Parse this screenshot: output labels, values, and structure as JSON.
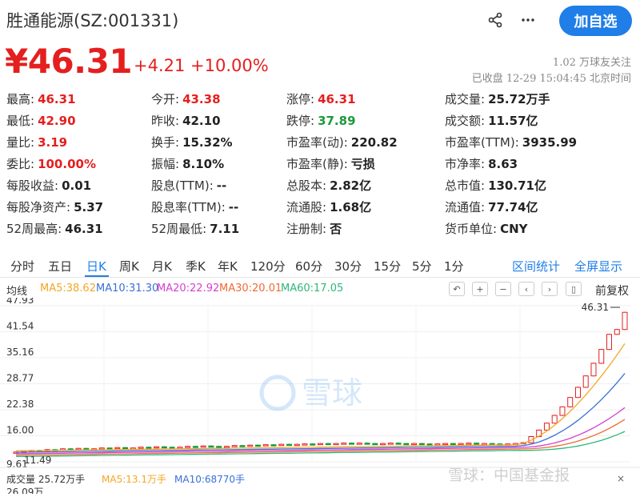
{
  "header": {
    "stock_name": "胜通能源(SZ:001331)",
    "add_button": "加自选",
    "share_icon": "share-icon",
    "more_icon": "more-icon"
  },
  "quote": {
    "price": "¥46.31",
    "change": "+4.21 +10.00%",
    "followers": "1.02 万球友关注",
    "status": "已收盘 12-29 15:04:45 北京时间"
  },
  "metrics": [
    [
      {
        "label": "最高:",
        "value": "46.31",
        "color": "red"
      },
      {
        "label": "今开:",
        "value": "43.38",
        "color": "red"
      },
      {
        "label": "涨停:",
        "value": "46.31",
        "color": "red"
      },
      {
        "label": "成交量:",
        "value": "25.72万手",
        "color": ""
      }
    ],
    [
      {
        "label": "最低:",
        "value": "42.90",
        "color": "red"
      },
      {
        "label": "昨收:",
        "value": "42.10",
        "color": ""
      },
      {
        "label": "跌停:",
        "value": "37.89",
        "color": "green"
      },
      {
        "label": "成交额:",
        "value": "11.57亿",
        "color": ""
      }
    ],
    [
      {
        "label": "量比:",
        "value": "3.19",
        "color": "red"
      },
      {
        "label": "换手:",
        "value": "15.32%",
        "color": ""
      },
      {
        "label": "市盈率(动):",
        "value": "220.82",
        "color": ""
      },
      {
        "label": "市盈率(TTM):",
        "value": "3935.99",
        "color": ""
      }
    ],
    [
      {
        "label": "委比:",
        "value": "100.00%",
        "color": "red"
      },
      {
        "label": "振幅:",
        "value": "8.10%",
        "color": ""
      },
      {
        "label": "市盈率(静):",
        "value": "亏损",
        "color": ""
      },
      {
        "label": "市净率:",
        "value": "8.63",
        "color": ""
      }
    ],
    [
      {
        "label": "每股收益:",
        "value": "0.01",
        "color": ""
      },
      {
        "label": "股息(TTM):",
        "value": "--",
        "color": ""
      },
      {
        "label": "总股本:",
        "value": "2.82亿",
        "color": ""
      },
      {
        "label": "总市值:",
        "value": "130.71亿",
        "color": ""
      }
    ],
    [
      {
        "label": "每股净资产:",
        "value": "5.37",
        "color": ""
      },
      {
        "label": "股息率(TTM):",
        "value": "--",
        "color": ""
      },
      {
        "label": "流通股:",
        "value": "1.68亿",
        "color": ""
      },
      {
        "label": "流通值:",
        "value": "77.74亿",
        "color": ""
      }
    ],
    [
      {
        "label": "52周最高:",
        "value": "46.31",
        "color": ""
      },
      {
        "label": "52周最低:",
        "value": "7.11",
        "color": ""
      },
      {
        "label": "注册制:",
        "value": "否",
        "color": ""
      },
      {
        "label": "货币单位:",
        "value": "CNY",
        "color": ""
      }
    ]
  ],
  "tabs": {
    "items": [
      "分时",
      "五日",
      "日K",
      "周K",
      "月K",
      "季K",
      "年K",
      "120分",
      "60分",
      "30分",
      "15分",
      "5分",
      "1分"
    ],
    "active": "日K",
    "interval_stats": "区间统计",
    "fullscreen": "全屏显示"
  },
  "ma_bar": {
    "label": "均线",
    "items": [
      {
        "text": "MA5:38.62",
        "color": "#f5a623"
      },
      {
        "text": "MA10:31.30",
        "color": "#3a6fd8"
      },
      {
        "text": "MA20:22.92",
        "color": "#d43fd0"
      },
      {
        "text": "MA30:20.01",
        "color": "#f06a35"
      },
      {
        "text": "MA60:17.05",
        "color": "#2fb77a"
      }
    ],
    "controls": [
      "undo-icon",
      "zoom-in-icon",
      "zoom-out-icon",
      "prev-icon",
      "next-icon",
      "candle-icon"
    ],
    "fuquan": "前复权"
  },
  "chart_data": {
    "type": "candlestick",
    "y_ticks": [
      "47.93",
      "41.54",
      "35.16",
      "28.77",
      "22.38",
      "16.00",
      "9.61"
    ],
    "ylim": [
      9.61,
      47.93
    ],
    "max_label": "46.31",
    "min_label": "11.49",
    "watermark": "雪球",
    "closes": [
      12.0,
      12.2,
      12.4,
      12.3,
      12.6,
      12.5,
      12.8,
      12.7,
      12.9,
      12.6,
      12.8,
      13.0,
      12.9,
      13.1,
      12.9,
      13.0,
      13.2,
      13.1,
      13.3,
      13.2,
      13.0,
      13.2,
      13.4,
      13.3,
      13.5,
      13.4,
      13.2,
      13.4,
      13.6,
      13.5,
      13.7,
      13.6,
      13.8,
      13.7,
      13.9,
      13.8,
      13.9,
      14.0,
      13.9,
      14.1,
      14.0,
      14.1,
      14.2,
      14.1,
      14.2,
      14.1,
      14.0,
      14.1,
      14.2,
      14.1,
      14.0,
      14.1,
      14.0,
      13.9,
      14.0,
      14.1,
      14.0,
      14.1,
      14.2,
      14.0,
      14.1,
      14.0,
      13.9,
      14.0,
      14.1,
      14.3,
      15.8,
      17.4,
      19.1,
      21.0,
      23.1,
      25.4,
      27.9,
      30.7,
      33.8,
      37.2,
      40.9,
      42.1,
      46.31
    ],
    "ma": [
      {
        "name": "MA5",
        "color": "#f5a623",
        "end": 38.62
      },
      {
        "name": "MA10",
        "color": "#3a6fd8",
        "end": 31.3
      },
      {
        "name": "MA20",
        "color": "#d43fd0",
        "end": 22.92
      },
      {
        "name": "MA30",
        "color": "#f06a35",
        "end": 20.01
      },
      {
        "name": "MA60",
        "color": "#2fb77a",
        "end": 17.05
      }
    ]
  },
  "volume_bar": {
    "label": "成交量 25.72万手",
    "ma5": "MA5:13.1万手",
    "ma10": "MA10:68770手",
    "next_tick": "26.09万"
  },
  "watermark_bottom": "雪球：中国基金报"
}
